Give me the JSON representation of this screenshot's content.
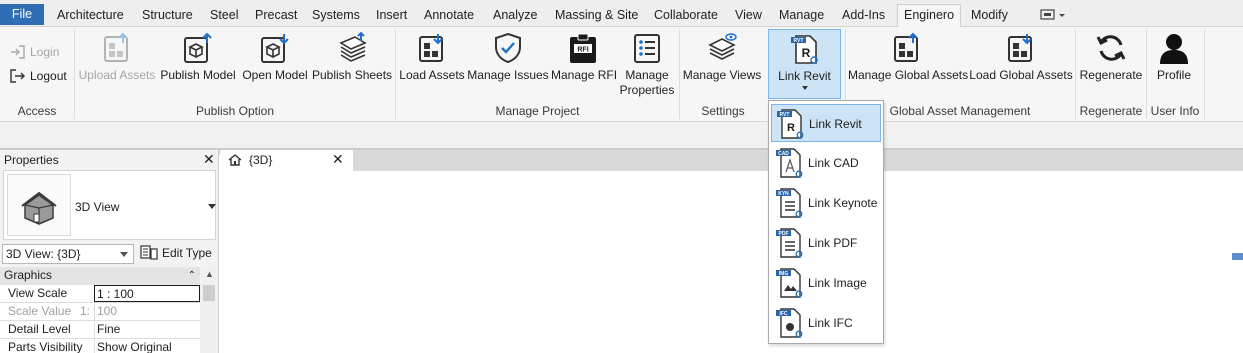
{
  "menubar": {
    "file": "File",
    "tabs": [
      "Architecture",
      "Structure",
      "Steel",
      "Precast",
      "Systems",
      "Insert",
      "Annotate",
      "Analyze",
      "Massing & Site",
      "Collaborate",
      "View",
      "Manage",
      "Add-Ins",
      "Enginero",
      "Modify"
    ],
    "active": "Enginero"
  },
  "ribbon": {
    "access": {
      "login": "Login",
      "logout": "Logout",
      "panel": "Access"
    },
    "publish": {
      "upload": "Upload Assets",
      "publish_model": "Publish Model",
      "open_model": "Open Model",
      "publish_sheets": "Publish Sheets",
      "panel": "Publish Option"
    },
    "project": {
      "load_assets": "Load Assets",
      "manage_issues": "Manage Issues",
      "manage_rfi": "Manage RFI",
      "manage_properties": "Manage\nProperties",
      "panel": "Manage Project"
    },
    "settings": {
      "manage_views": "Manage Views",
      "panel": "Settings"
    },
    "link_revit": "Link Revit",
    "global": {
      "manage": "Manage Global Assets",
      "load": "Load Global Assets",
      "panel": "Global Asset Management"
    },
    "regenerate": {
      "label": "Regenerate",
      "panel": "Regenerate"
    },
    "user": {
      "profile": "Profile",
      "panel": "User Info"
    }
  },
  "dropdown": {
    "items": [
      {
        "label": "Link Revit",
        "tag": "RVT",
        "glyph": "R",
        "highlighted": true
      },
      {
        "label": "Link CAD",
        "tag": "CAD",
        "glyph": "A"
      },
      {
        "label": "Link Keynote",
        "tag": "KYN",
        "glyph": "≡"
      },
      {
        "label": "Link PDF",
        "tag": "PDF",
        "glyph": "≡"
      },
      {
        "label": "Link Image",
        "tag": "IMG",
        "glyph": "▲"
      },
      {
        "label": "Link IFC",
        "tag": "IFC",
        "glyph": "●"
      }
    ]
  },
  "properties": {
    "title": "Properties",
    "type_name": "3D View",
    "instance_selector": "3D View: {3D}",
    "edit_type": "Edit Type",
    "section": "Graphics",
    "rows": [
      {
        "key": "View Scale",
        "value": "1 : 100"
      },
      {
        "key": "Scale Value",
        "value": "100",
        "prefix": "1:"
      },
      {
        "key": "Detail Level",
        "value": "Fine"
      },
      {
        "key": "Parts Visibility",
        "value": "Show Original"
      }
    ]
  },
  "view": {
    "tab_label": "{3D}"
  },
  "colors": {
    "file_tab": "#2f6db5",
    "accent": "#1f6fc9",
    "highlight": "#cde4f7"
  }
}
